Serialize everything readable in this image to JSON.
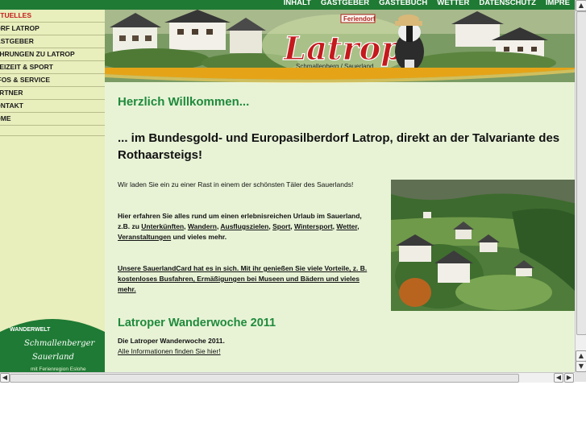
{
  "topnav": [
    "INHALT",
    "GASTGEBER",
    "GASTEBUCH",
    "WETTER",
    "DATENSCHUTZ",
    "IMPRE"
  ],
  "menu": [
    {
      "label": "AKTUELLES",
      "active": true
    },
    {
      "label": "DORF LATROP",
      "active": false
    },
    {
      "label": "GASTGEBER",
      "active": false
    },
    {
      "label": "FÜHRUNGEN ZU LATROP",
      "active": false
    },
    {
      "label": "FREIZEIT & SPORT",
      "active": false
    },
    {
      "label": "INFOS & SERVICE",
      "active": false
    },
    {
      "label": "PARTNER",
      "active": false
    },
    {
      "label": "KONTAKT",
      "active": false
    },
    {
      "label": "HOME",
      "active": false
    }
  ],
  "header": {
    "badge": "Feriendorf",
    "logo": "Latrop",
    "tagline": "Schmallenberg / Sauerland"
  },
  "sidebar_logo": {
    "top": "WANDERWELT",
    "script1": "Schmallenberger",
    "script2": "Sauerland",
    "bottom": "mit Ferienregion Eslohe"
  },
  "content": {
    "welcome": "Herzlich Willkommen...",
    "subtitle_line1": "... im Bundesgold- und Europasilberdorf Latrop, direkt an der Talvariante des",
    "subtitle_line2": "Rothaarsteigs!",
    "intro": "Wir laden Sie ein zu einer Rast in einem der schönsten Täler des Sauerlands!",
    "info_prefix": "Hier erfahren Sie alles rund um einen erlebnisreichen Urlaub im Sauerland, z.B. zu ",
    "info_links": [
      "Unterkünften",
      "Wandern",
      "Ausflugszielen",
      "Sport",
      "Wintersport",
      "Wetter",
      "Veranstaltungen"
    ],
    "info_suffix": " und vieles mehr.",
    "card_text": "Unsere SauerlandCard hat es in sich. Mit ihr genießen Sie viele Vorteile, z. B. kostenloses Busfahren, Ermäßigungen bei Museen und Bädern und vieles mehr.",
    "week_title": "Latroper Wanderwoche 2011",
    "week_text": "Die Latroper Wanderwoche 2011.",
    "week_link": "Alle Informationen finden Sie hier!"
  },
  "colors": {
    "topbar": "#1f7a34",
    "accent_green": "#1f8a3c",
    "content_bg": "#e8f3d6",
    "sidebar_bg": "#e8eebc",
    "active_red": "#c51a1a"
  }
}
